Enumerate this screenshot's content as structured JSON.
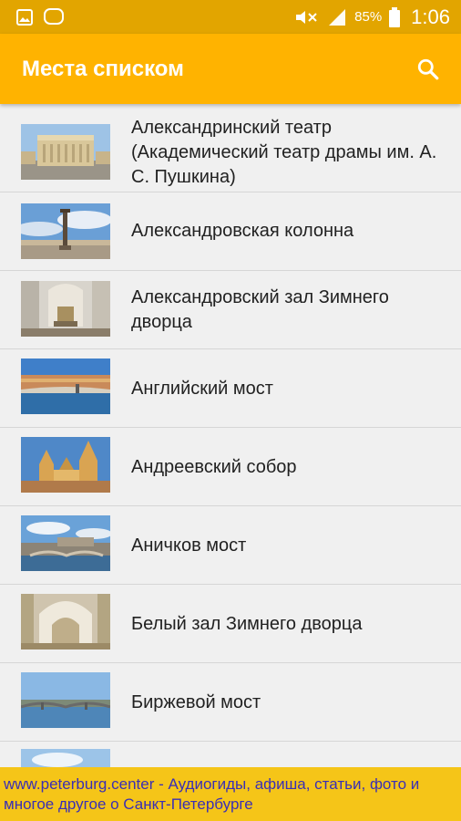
{
  "status_bar": {
    "battery_percent": "85%",
    "time": "1:06"
  },
  "app_bar": {
    "title": "Места списком",
    "search_icon": "search-icon"
  },
  "places": [
    {
      "label": "Александринский театр (Академический театр драмы им. А. С. Пушкина)"
    },
    {
      "label": "Александровская колонна"
    },
    {
      "label": "Александровский зал Зимнего дворца"
    },
    {
      "label": "Английский мост"
    },
    {
      "label": "Андреевский собор"
    },
    {
      "label": "Аничков мост"
    },
    {
      "label": "Белый зал Зимнего дворца"
    },
    {
      "label": "Биржевой мост"
    },
    {
      "label": ""
    }
  ],
  "footer": {
    "text": "www.peterburg.center - Аудиогиды, афиша, статьи, фото и многое другое о Санкт-Петербурге"
  }
}
